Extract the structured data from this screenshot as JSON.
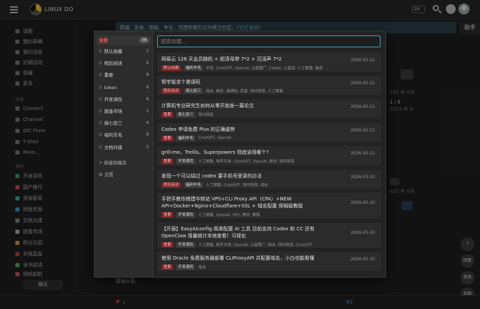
{
  "site": {
    "title": "LINUX DO",
    "lang": "ZH"
  },
  "banner": {
    "text": "真诚、友善、团结、专业，共建你我引以为荣之社区。",
    "link": "《社区准则》"
  },
  "helper_label": "助手",
  "sidebar": {
    "items": [
      "话题",
      "我的草稿",
      "我的消息",
      "近期活动",
      "收藏",
      "更多"
    ],
    "section_resources": "资源",
    "resources": [
      "Connect",
      "Channel",
      "IDC Flare",
      "T-Shirt",
      "More..."
    ],
    "section_categories": "类别",
    "categories": [
      "开发调优",
      "国产替代",
      "资源荟萃",
      "网盘资源",
      "文档共建",
      "跳蚤市场",
      "积分乐园",
      "非我莫属",
      "读书成诗",
      "扬帆起航"
    ],
    "chat_button": "聊天"
  },
  "background": {
    "frag_year1": "025 年 8月",
    "frag_page": "1 / 6",
    "frag_year2": "2025 年 8",
    "frag_year3": "025 年 8月",
    "frag_share": "感谢分享。",
    "reply_count": "#2",
    "round_buttons": [
      "回复",
      "修改",
      "加链"
    ]
  },
  "modal": {
    "search_placeholder": "搜索收藏...",
    "categories": [
      {
        "label": "全部",
        "count": "38",
        "active": true
      },
      {
        "label": "默认收藏",
        "count": "1"
      },
      {
        "label": "稍后阅读",
        "count": "6"
      },
      {
        "label": "重要",
        "count": "8"
      },
      {
        "label": "token",
        "count": "6"
      },
      {
        "label": "开发调优",
        "count": "6"
      },
      {
        "label": "跳蚤市场",
        "count": "1"
      },
      {
        "label": "搞七捻三",
        "count": "4"
      },
      {
        "label": "福利羊毛",
        "count": "6"
      },
      {
        "label": "文档共建",
        "count": "0"
      }
    ],
    "new_folder": "新建收藏夹",
    "settings": "设置",
    "items": [
      {
        "title": "网易云 128 天会员随机 + 超清母带 7*2 + 沉浸声 7*2",
        "date": "2026-05-12",
        "badges": [
          {
            "text": "默认收藏",
            "style": "red"
          },
          {
            "text": "福利羊毛",
            "style": "dark"
          }
        ],
        "tags": "羊毛, ChatGPT, OpenAI, 公益推广, Codex, 公益站, 人工智能, 抽奖"
      },
      {
        "title": "帮学姐求个邀请码",
        "date": "2026-05-12",
        "badges": [
          {
            "text": "稍后阅读",
            "style": "red"
          },
          {
            "text": "搞七捻三",
            "style": "dark"
          }
        ],
        "tags": "纯水, 病友, 邀请码, 恋爱, 快问快答, 人工智能"
      },
      {
        "title": "计算机专业研究生如何从零开始发一篇论文",
        "date": "2026-05-11",
        "badges": [
          {
            "text": "重要",
            "style": "red"
          },
          {
            "text": "搞七捻三",
            "style": "dark"
          }
        ],
        "tags": "快问快答"
      },
      {
        "title": "Codex 申请免费 Plus 的正确姿势",
        "date": "2026-05-11",
        "badges": [
          {
            "text": "重要",
            "style": "red"
          },
          {
            "text": "福利羊毛",
            "style": "dark"
          }
        ],
        "tags": "ChatGPT, OpenAI"
      },
      {
        "title": "grill-me、Trellis、Superpowers 到底该用哪个?",
        "date": "2026-05-11",
        "badges": [
          {
            "text": "重要",
            "style": "red"
          },
          {
            "text": "开发调优",
            "style": "dark"
          }
        ],
        "tags": "人工智能, 软件开发, ChatGPT, OpenAI, 原创, 快问快答"
      },
      {
        "title": "发现一个可以绕过 codex 要手机号登录的办法",
        "date": "2026-05-10",
        "badges": [
          {
            "text": "稍后阅读",
            "style": "red"
          },
          {
            "text": "福利羊毛",
            "style": "dark"
          }
        ],
        "tags": "人工智能, ChatGPT, 快问快答, 纯水"
      },
      {
        "title": "手把手教你搭建中转站 VPS+CLI Proxy API（CPA）+NEW API+Docker+Nginx+Cloudflare+SSL + 域名配置 保姆级教程",
        "date": "2026-05-10",
        "badges": [
          {
            "text": "重要",
            "style": "red"
          },
          {
            "text": "开发调优",
            "style": "dark"
          }
        ],
        "tags": "人工智能, OpenAI, VPS, 原创, 教程"
      },
      {
        "title": "【开源】EasyAIconfig 简单配置 AI 工具 目前支持 Codex 和 CC 还有 OpenClaw 用量统计本地查看！可视化",
        "date": "2026-05-10",
        "badges": [
          {
            "text": "重要",
            "style": "red"
          },
          {
            "text": "开发调优",
            "style": "dark"
          }
        ],
        "tags": "人工智能, 软件开发, OpenAI, 公益推广, 纯水, 快问快答, ChatGPT"
      },
      {
        "title": "使用 Oracle 免费服务器部署 CLIProxyAPI 并配置域名，小白也能看懂",
        "date": "2026-05-10",
        "badges": [
          {
            "text": "重要",
            "style": "red"
          },
          {
            "text": "开发调优",
            "style": "dark"
          }
        ],
        "tags": "纯水"
      }
    ]
  }
}
